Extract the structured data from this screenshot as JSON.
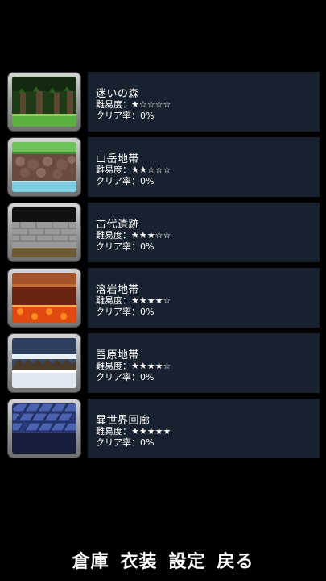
{
  "stages": [
    {
      "name": "迷いの森",
      "difficulty": "難易度：★☆☆☆☆",
      "clear": "クリア率：0%",
      "thumb_icon": "forest-thumbnail-icon"
    },
    {
      "name": "山岳地帯",
      "difficulty": "難易度：★★☆☆☆",
      "clear": "クリア率：0%",
      "thumb_icon": "mountain-thumbnail-icon"
    },
    {
      "name": "古代遺跡",
      "difficulty": "難易度：★★★☆☆",
      "clear": "クリア率：0%",
      "thumb_icon": "ruins-thumbnail-icon"
    },
    {
      "name": "溶岩地帯",
      "difficulty": "難易度：★★★★☆",
      "clear": "クリア率：0%",
      "thumb_icon": "lava-thumbnail-icon"
    },
    {
      "name": "雪原地帯",
      "difficulty": "難易度：★★★★☆",
      "clear": "クリア率：0%",
      "thumb_icon": "snowfield-thumbnail-icon"
    },
    {
      "name": "異世界回廊",
      "difficulty": "難易度：★★★★★",
      "clear": "クリア率：0%",
      "thumb_icon": "otherworld-thumbnail-icon"
    }
  ],
  "bottom_menu": {
    "storage": "倉庫",
    "costume": "衣装",
    "settings": "設定",
    "back": "戻る"
  },
  "colors": {
    "background": "#000000",
    "panel": "#18222e",
    "frame": "#9a9a9a"
  }
}
